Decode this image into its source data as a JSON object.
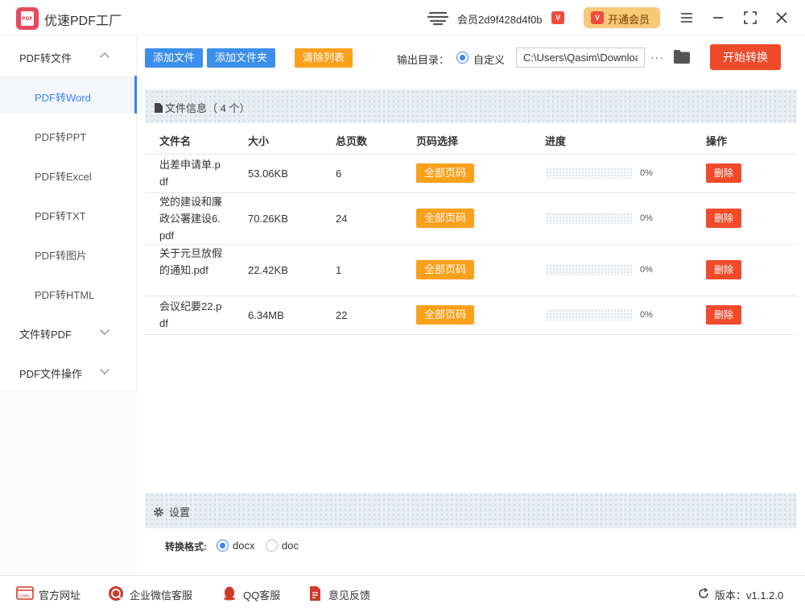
{
  "app": {
    "title": "优速PDF工厂",
    "logo_text": "PDF"
  },
  "user": {
    "member_name": "会员2d9f428d4f0b",
    "vip_label": "开通会员"
  },
  "sidebar": {
    "groups": [
      {
        "label": "PDF转文件",
        "expanded": true
      },
      {
        "label": "文件转PDF",
        "expanded": false
      },
      {
        "label": "PDF文件操作",
        "expanded": false
      }
    ],
    "items": [
      "PDF转Word",
      "PDF转PPT",
      "PDF转Excel",
      "PDF转TXT",
      "PDF转图片",
      "PDF转HTML"
    ],
    "active_item": "PDF转Word"
  },
  "toolbar": {
    "add_file": "添加文件",
    "add_folder": "添加文件夹",
    "clear_list": "清除列表",
    "output_label": "输出目录：",
    "custom_label": "自定义",
    "output_path": "C:\\Users\\Qasim\\Downloads",
    "more": "···",
    "start": "开始转换"
  },
  "file_panel": {
    "title": "文件信息（ 4 个）",
    "columns": [
      "文件名",
      "大小",
      "总页数",
      "页码选择",
      "进度",
      "操作"
    ],
    "rows": [
      {
        "name": "出差申请单.pdf",
        "size": "53.06KB",
        "pages": "6",
        "page_select": "全部页码",
        "progress": 0,
        "progress_text": "0%",
        "action": "删除"
      },
      {
        "name": "党的建设和廉政公署建设6.pdf",
        "size": "70.26KB",
        "pages": "24",
        "page_select": "全部页码",
        "progress": 0,
        "progress_text": "0%",
        "action": "删除"
      },
      {
        "name": "关于元旦放假的通知.pdf",
        "size": "22.42KB",
        "pages": "1",
        "page_select": "全部页码",
        "progress": 0,
        "progress_text": "0%",
        "action": "删除"
      },
      {
        "name": "会议纪要22.pdf",
        "size": "6.34MB",
        "pages": "22",
        "page_select": "全部页码",
        "progress": 0,
        "progress_text": "0%",
        "action": "删除"
      }
    ]
  },
  "settings": {
    "title": "设置",
    "format_label": "转换格式:",
    "options": [
      "docx",
      "doc"
    ],
    "selected": "docx"
  },
  "footer": {
    "website": "官方网址",
    "wechat": "企业微信客服",
    "qq": "QQ客服",
    "feedback": "意见反馈",
    "version": "版本：v1.1.2.0"
  },
  "colors": {
    "accent_blue": "#3b8fea",
    "orange": "#f9a11b",
    "red": "#ef4a2a",
    "brand": "#e84a5f"
  }
}
